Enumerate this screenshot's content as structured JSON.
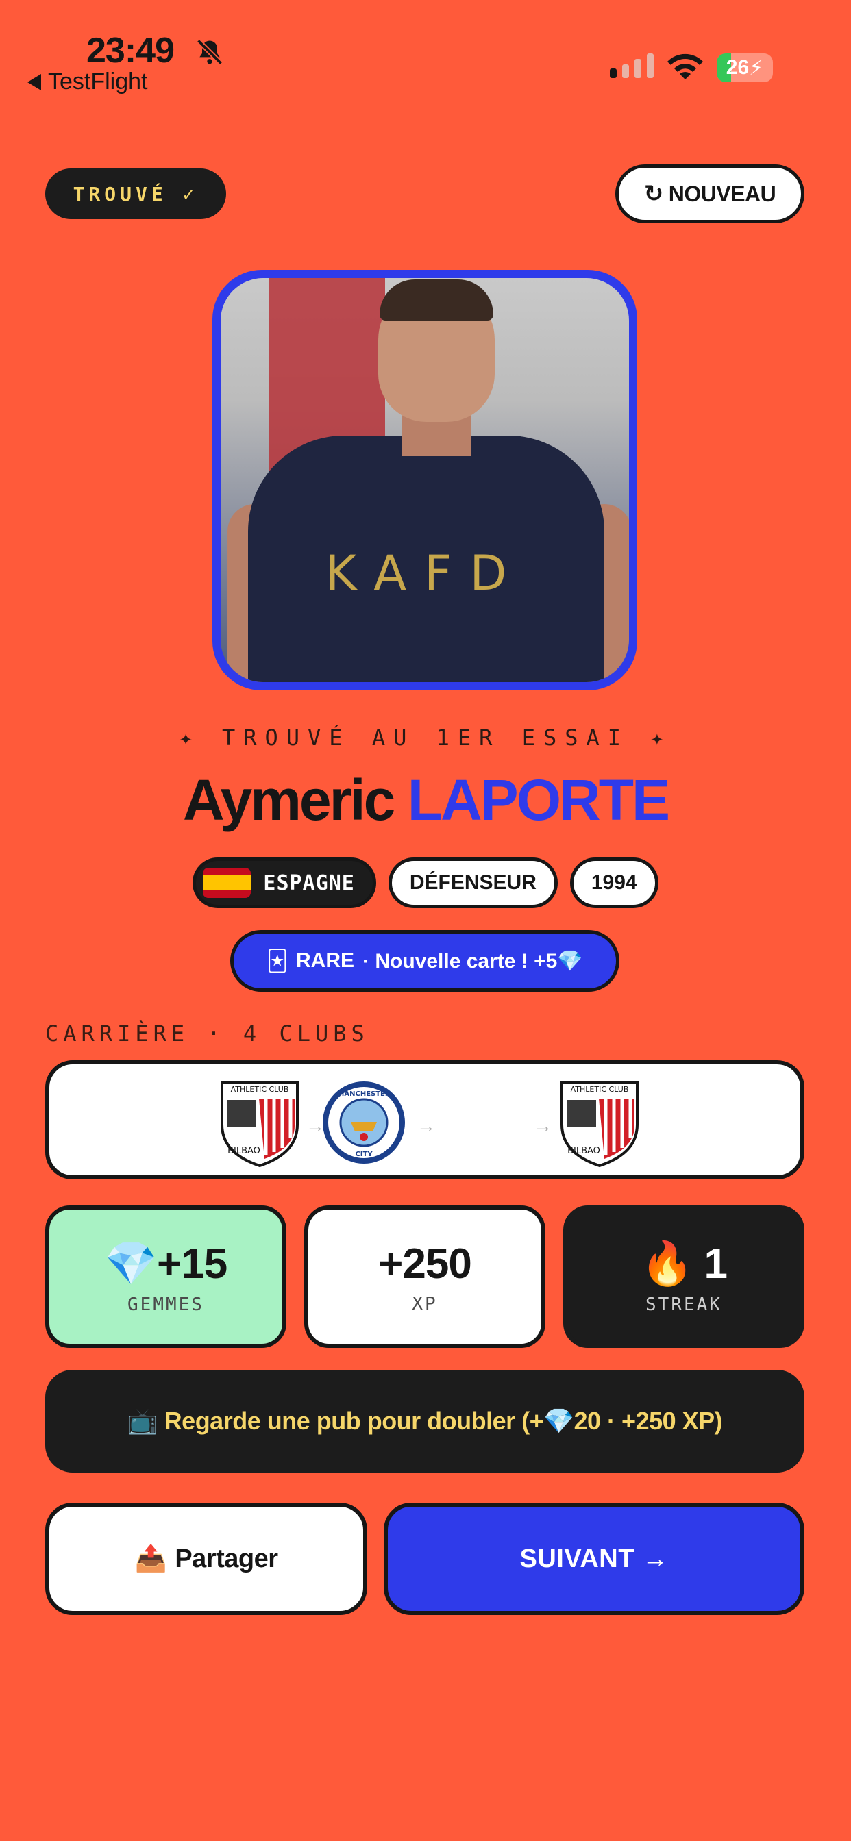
{
  "status_bar": {
    "time": "23:49",
    "back_label": "TestFlight",
    "battery": "26",
    "battery_level": 0.26
  },
  "header": {
    "found_label": "TROUVÉ ✓",
    "new_button": "NOUVEAU",
    "new_icon": "refresh-icon"
  },
  "result": {
    "found_note": "✦ TROUVÉ AU 1ER ESSAI ✦",
    "first_name": "Aymeric",
    "last_name": "LAPORTE",
    "country": "ESPAGNE",
    "position": "DÉFENSEUR",
    "year": "1994",
    "rarity_icon": "🃏",
    "rarity": "RARE",
    "card_note": "· Nouvelle carte ! +5💎"
  },
  "career": {
    "title": "CARRIÈRE · 4 CLUBS",
    "clubs": [
      "ATHLETIC CLUB BILBAO",
      "MANCHESTER CITY",
      "",
      "ATHLETIC CLUB BILBAO"
    ]
  },
  "stats": {
    "gems_value": "💎+15",
    "gems_label": "GEMMES",
    "xp_value": "+250",
    "xp_label": "XP",
    "streak_value": "🔥 1",
    "streak_label": "STREAK"
  },
  "actions": {
    "ad_label": "📺 Regarde une pub pour doubler (+💎20 · +250 XP)",
    "share_icon": "📤",
    "share_label": "Partager",
    "next_label": "SUIVANT →"
  },
  "colors": {
    "background": "#FF5A3A",
    "accent_blue": "#2F3BEA",
    "dark": "#1C1C1C",
    "gold": "#F6D66A",
    "mint": "#A8F2C4"
  }
}
